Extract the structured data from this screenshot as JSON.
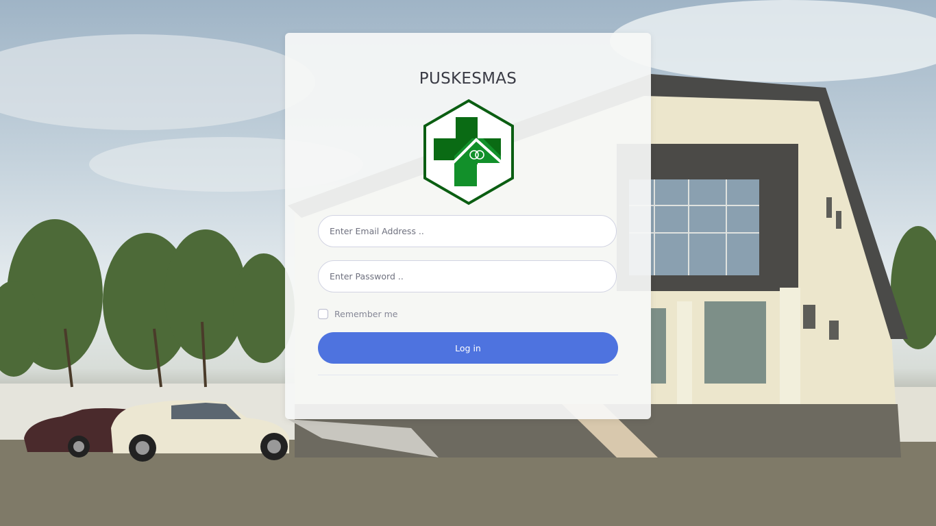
{
  "page": {
    "title": "PUSKESMAS"
  },
  "logo": {
    "icon": "puskesmas-logo-icon",
    "colors": {
      "dark_green": "#0a6b14",
      "green": "#12902a",
      "outline": "#0b5e12"
    }
  },
  "form": {
    "email_placeholder": "Enter Email Address ..",
    "email_value": "",
    "password_placeholder": "Enter Password ..",
    "password_value": "",
    "remember_label": "Remember me",
    "remember_checked": false,
    "login_label": "Log in"
  },
  "colors": {
    "primary": "#4e73df",
    "card_bg": "#f6f7f6",
    "text_dark": "#3a3b45",
    "text_muted": "#858796"
  }
}
